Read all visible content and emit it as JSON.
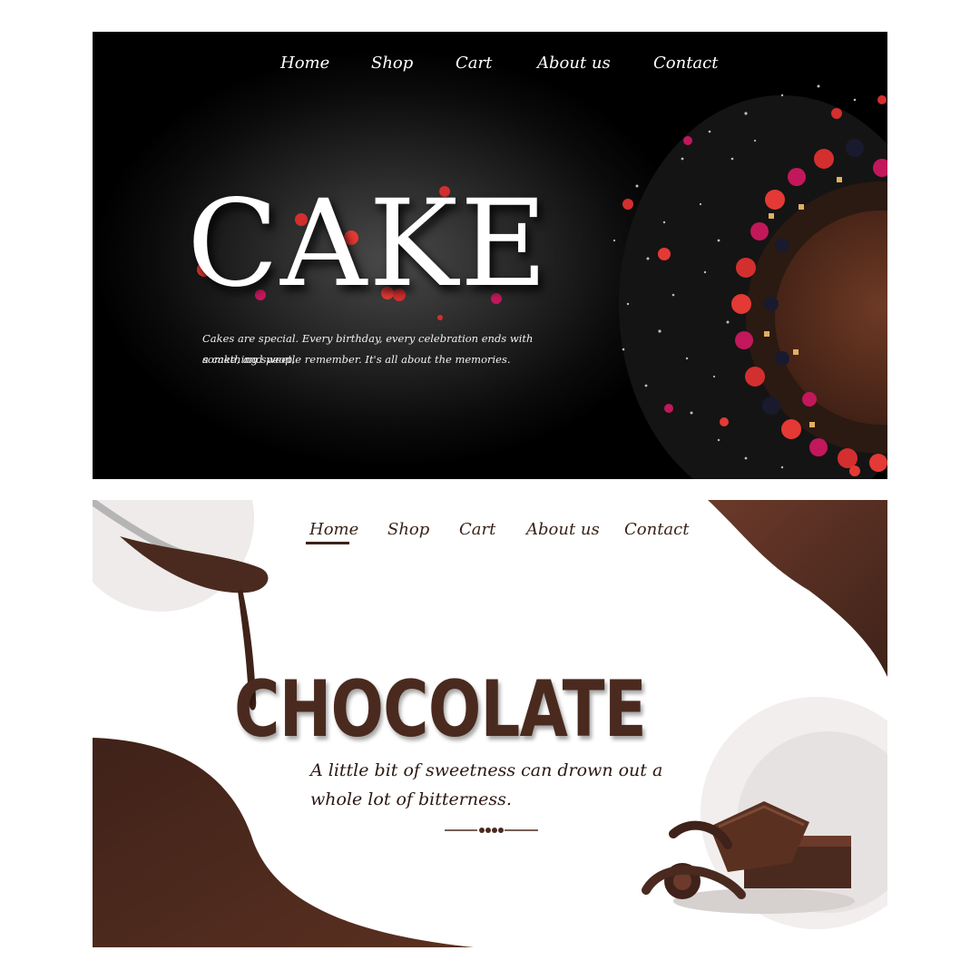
{
  "cake_page": {
    "nav": [
      {
        "label": "Home"
      },
      {
        "label": "Shop"
      },
      {
        "label": "Cart"
      },
      {
        "label": "About us"
      },
      {
        "label": "Contact"
      }
    ],
    "title": "CAKE",
    "tagline_lines": [
      "Cakes are special. Every birthday, every celebration ends with something sweet,",
      "a cake, and people remember. It's all about the memories."
    ]
  },
  "chocolate_page": {
    "nav": [
      {
        "label": "Home",
        "active": true
      },
      {
        "label": "Shop"
      },
      {
        "label": "Cart"
      },
      {
        "label": "About us"
      },
      {
        "label": "Contact"
      }
    ],
    "title": "CHOCOLATE",
    "tagline_lines": [
      "A little bit of sweetness can drown out a",
      "whole lot of bitterness."
    ],
    "slider_dots": 4
  },
  "colors": {
    "cake_background": "#000000",
    "cake_text": "#ffffff",
    "chocolate_brown": "#4a2a1f",
    "chocolate_text": "#2b1812",
    "berry_red": "#d32f2f"
  }
}
